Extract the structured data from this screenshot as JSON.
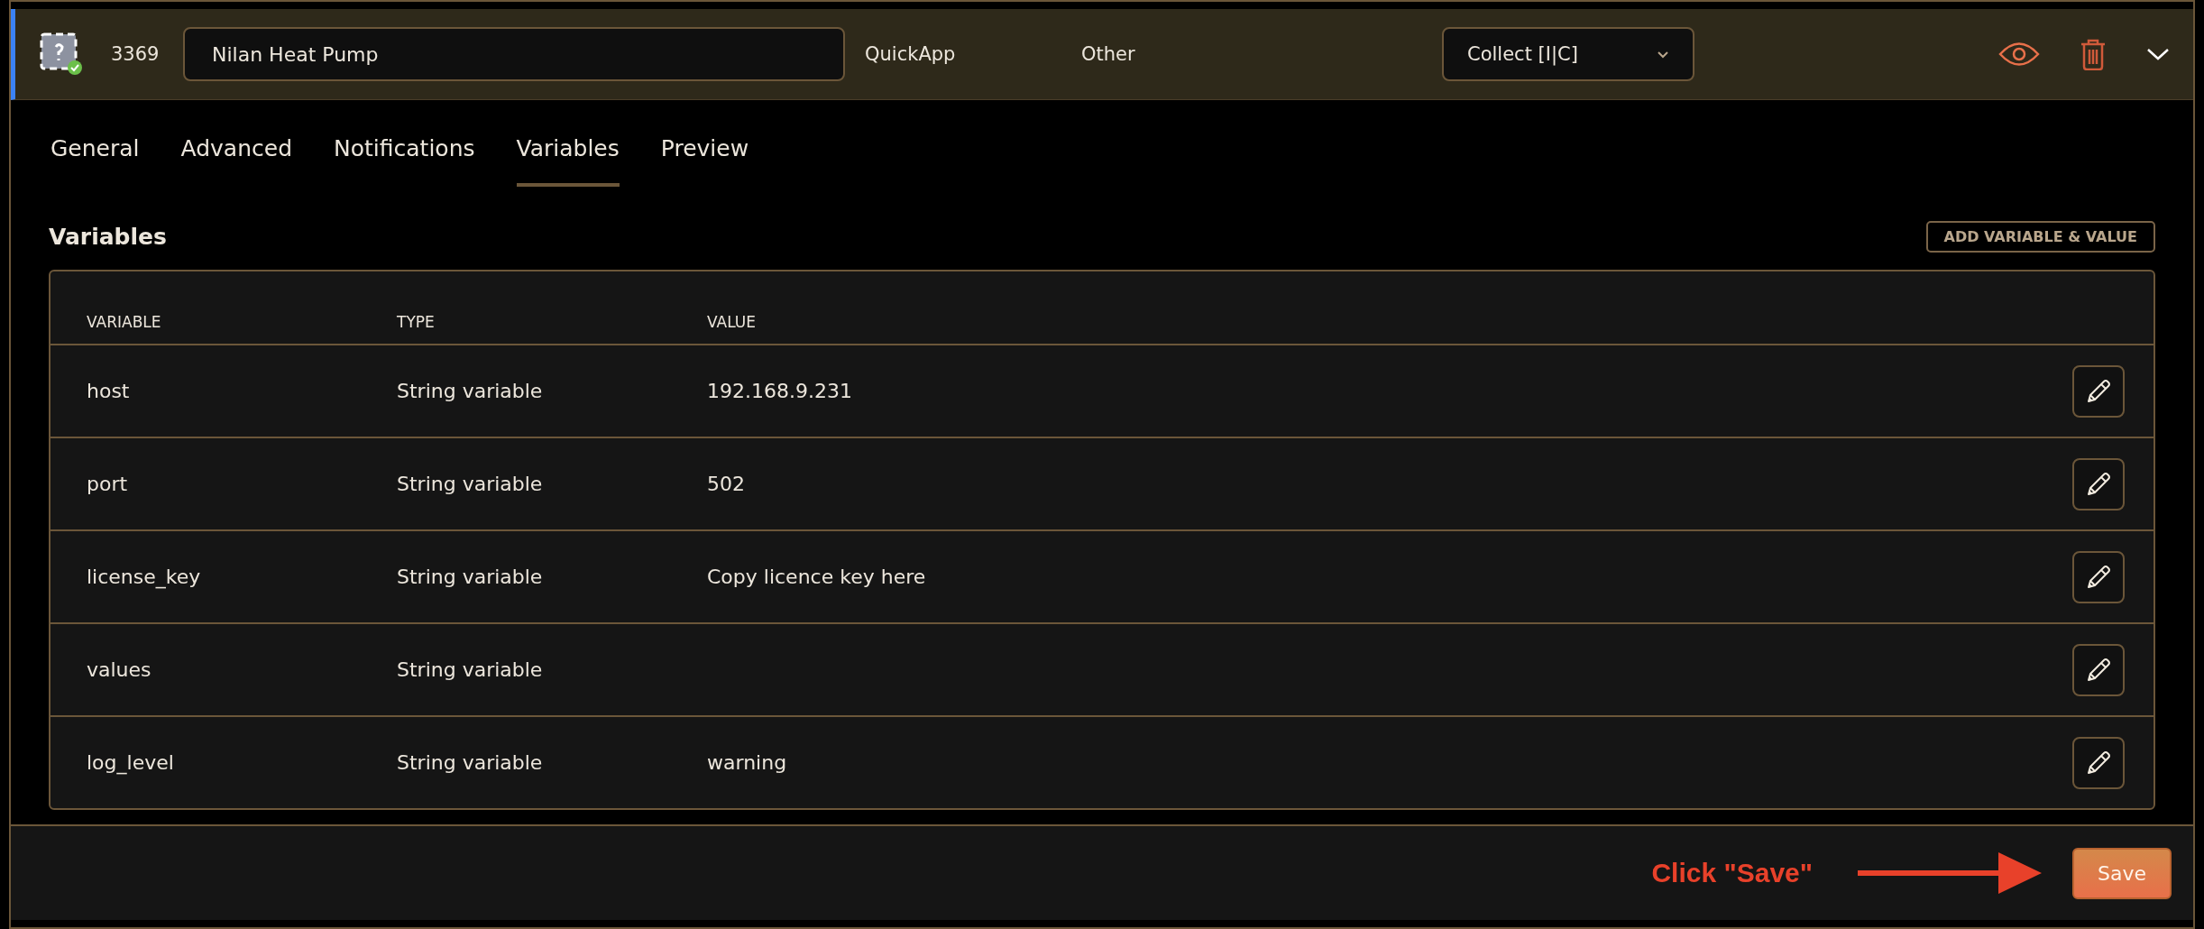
{
  "header": {
    "id": "3369",
    "name": "Nilan Heat Pump",
    "type": "QuickApp",
    "category": "Other",
    "mode": "Collect [I|C]",
    "status_ok": true
  },
  "tabs": [
    {
      "label": "General",
      "selected": false
    },
    {
      "label": "Advanced",
      "selected": false
    },
    {
      "label": "Notifications",
      "selected": false
    },
    {
      "label": "Variables",
      "selected": true
    },
    {
      "label": "Preview",
      "selected": false
    }
  ],
  "section_title": "Variables",
  "add_button": "ADD VARIABLE & VALUE",
  "table": {
    "columns": [
      "VARIABLE",
      "TYPE",
      "VALUE"
    ],
    "rows": [
      {
        "variable": "host",
        "type": "String variable",
        "value": "192.168.9.231"
      },
      {
        "variable": "port",
        "type": "String variable",
        "value": "502"
      },
      {
        "variable": "license_key",
        "type": "String variable",
        "value": "Copy licence key here"
      },
      {
        "variable": "values",
        "type": "String variable"
      },
      {
        "variable": "log_level",
        "type": "String variable",
        "value": "warning"
      }
    ]
  },
  "annotation": "Click \"Save\"",
  "save_button": "Save"
}
